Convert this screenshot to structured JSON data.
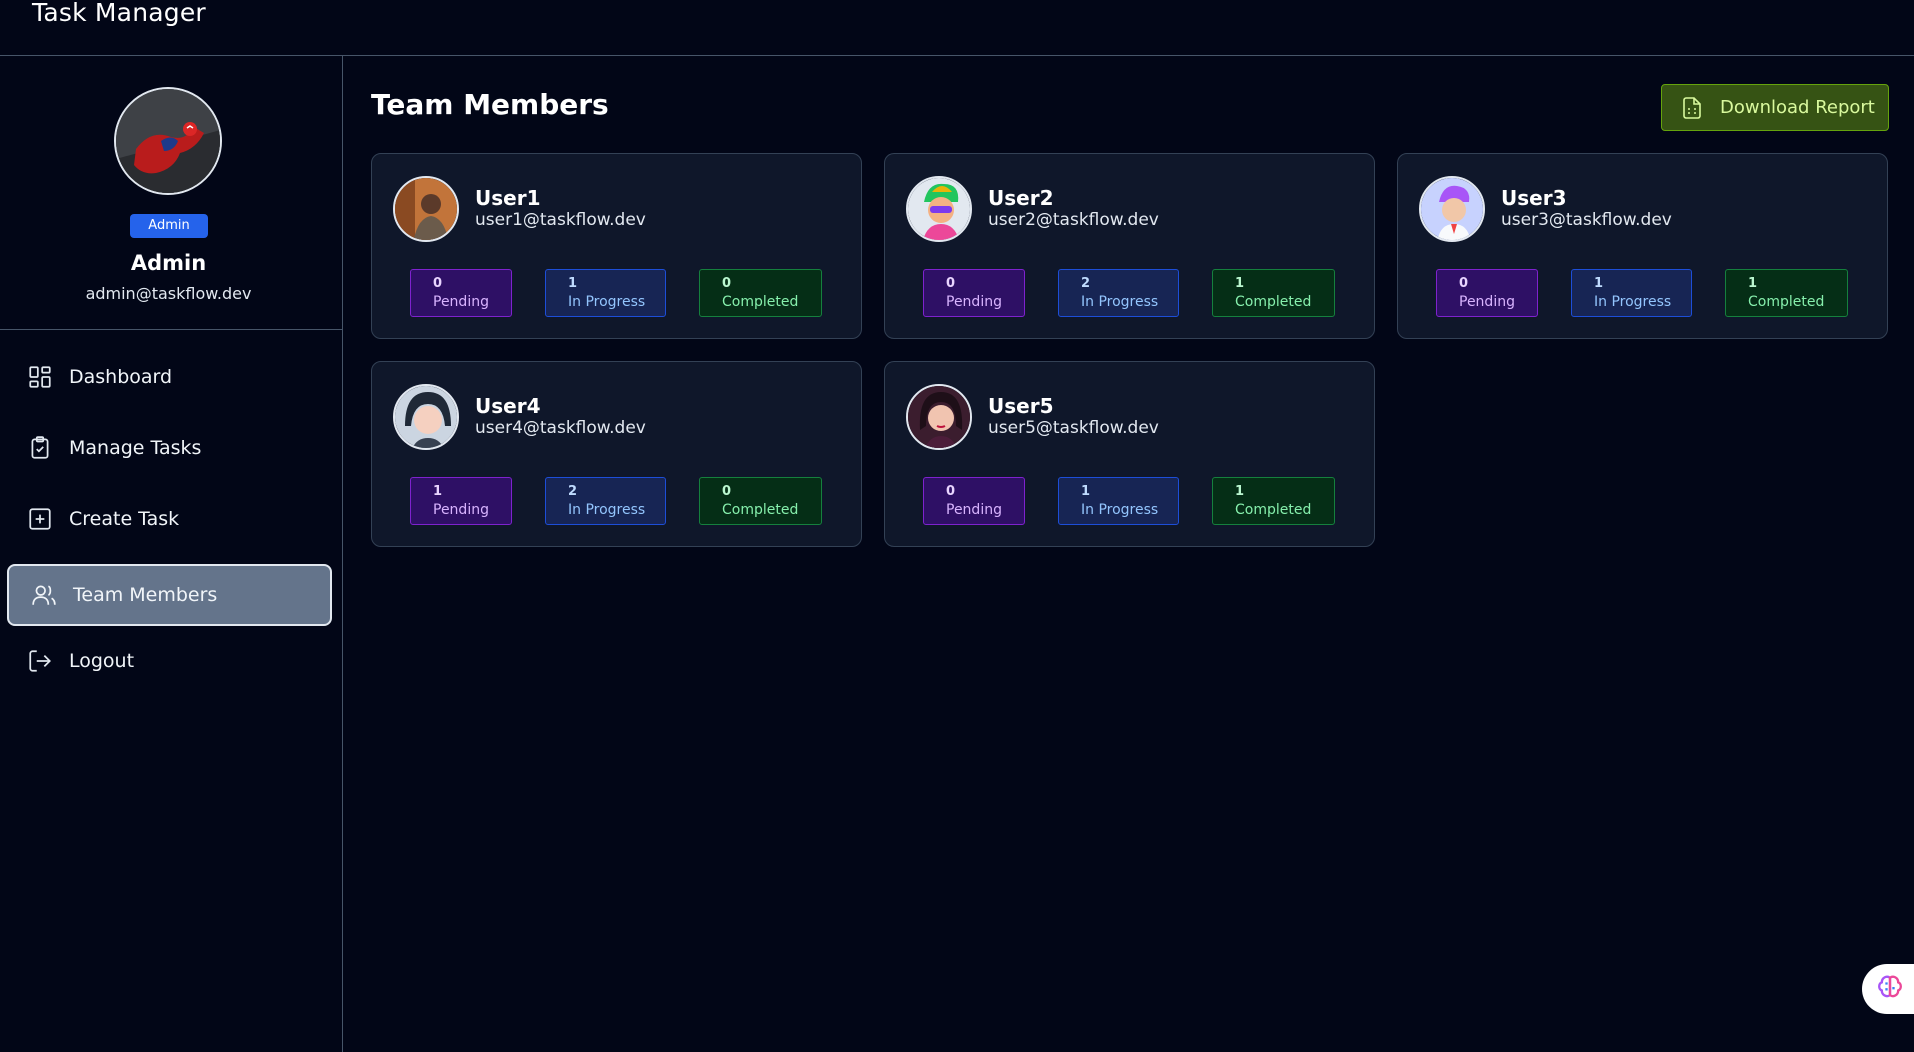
{
  "app": {
    "title": "Task Manager"
  },
  "profile": {
    "role": "Admin",
    "name": "Admin",
    "email": "admin@taskflow.dev",
    "avatar_icon": "spiderman-avatar"
  },
  "nav": {
    "items": [
      {
        "label": "Dashboard",
        "icon": "dashboard-icon",
        "active": false
      },
      {
        "label": "Manage Tasks",
        "icon": "clipboard-check-icon",
        "active": false
      },
      {
        "label": "Create Task",
        "icon": "plus-square-icon",
        "active": false
      },
      {
        "label": "Team Members",
        "icon": "users-icon",
        "active": true
      },
      {
        "label": "Logout",
        "icon": "logout-icon",
        "active": false
      }
    ]
  },
  "main": {
    "title": "Team Members",
    "download_label": "Download Report",
    "download_icon": "file-spreadsheet-icon"
  },
  "stat_labels": {
    "pending": "Pending",
    "progress": "In Progress",
    "completed": "Completed"
  },
  "members": [
    {
      "name": "User1",
      "email": "user1@taskflow.dev",
      "pending": "0",
      "in_progress": "1",
      "completed": "0"
    },
    {
      "name": "User2",
      "email": "user2@taskflow.dev",
      "pending": "0",
      "in_progress": "2",
      "completed": "1"
    },
    {
      "name": "User3",
      "email": "user3@taskflow.dev",
      "pending": "0",
      "in_progress": "1",
      "completed": "1"
    },
    {
      "name": "User4",
      "email": "user4@taskflow.dev",
      "pending": "1",
      "in_progress": "2",
      "completed": "0"
    },
    {
      "name": "User5",
      "email": "user5@taskflow.dev",
      "pending": "0",
      "in_progress": "1",
      "completed": "1"
    }
  ],
  "colors": {
    "background": "#020617",
    "card": "#0f172a",
    "pending": "#7e22ce",
    "in_progress": "#1d4ed8",
    "completed": "#15803d",
    "accent_button": "#365314",
    "role_badge": "#2563eb"
  },
  "floating": {
    "icon": "brain-icon"
  }
}
